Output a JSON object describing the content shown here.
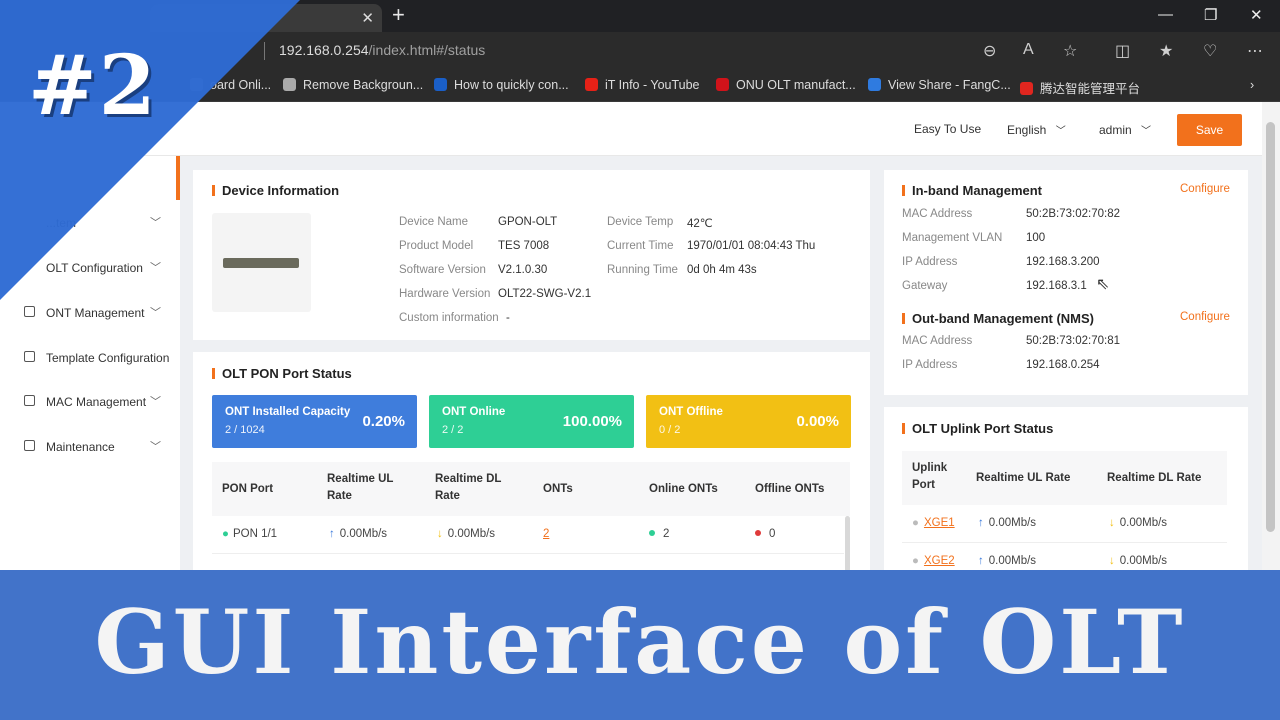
{
  "browser": {
    "url_host": "192.168.0.254",
    "url_path": "/index.html#/status",
    "bookmarks": [
      {
        "label": "oard Onli...",
        "color": "#888888"
      },
      {
        "label": "Remove Backgroun...",
        "color": "#aaaaaa"
      },
      {
        "label": "How to quickly con...",
        "color": "#1a5fc8"
      },
      {
        "label": "iT Info - YouTube",
        "color": "#e62117"
      },
      {
        "label": "ONU OLT manufact...",
        "color": "#d0131a"
      },
      {
        "label": "View Share - FangC...",
        "color": "#2f7be0"
      },
      {
        "label": "腾达智能管理平台",
        "color": "#e0261f"
      }
    ]
  },
  "header": {
    "easy_to_use": "Easy To Use",
    "language": "English",
    "user": "admin",
    "save": "Save"
  },
  "sidebar": {
    "items": [
      {
        "label": "...tem"
      },
      {
        "label": "OLT Configuration"
      },
      {
        "label": "ONT Management"
      },
      {
        "label": "Template Configuration"
      },
      {
        "label": "MAC Management"
      },
      {
        "label": "Maintenance"
      }
    ]
  },
  "device_info": {
    "title": "Device Information",
    "device_name_label": "Device Name",
    "device_name": "GPON-OLT",
    "product_model_label": "Product Model",
    "product_model": "TES 7008",
    "software_version_label": "Software Version",
    "software_version": "V2.1.0.30",
    "hardware_version_label": "Hardware Version",
    "hardware_version": "OLT22-SWG-V2.1",
    "custom_info_label": "Custom information",
    "custom_info": "-",
    "device_temp_label": "Device Temp",
    "device_temp": "42℃",
    "current_time_label": "Current Time",
    "current_time": "1970/01/01 08:04:43 Thu",
    "running_time_label": "Running Time",
    "running_time": "0d 0h 4m 43s"
  },
  "pon_status": {
    "title": "OLT PON Port Status",
    "kpis": [
      {
        "title": "ONT Installed Capacity",
        "sub": "2 / 1024",
        "pct": "0.20%",
        "color": "#3f7ddc"
      },
      {
        "title": "ONT Online",
        "sub": "2 / 2",
        "pct": "100.00%",
        "color": "#2ecf95"
      },
      {
        "title": "ONT Offline",
        "sub": "0 / 2",
        "pct": "0.00%",
        "color": "#f2c014"
      }
    ],
    "columns": [
      "PON Port",
      "Realtime UL Rate",
      "Realtime DL Rate",
      "ONTs",
      "Online ONTs",
      "Offline ONTs"
    ],
    "rows": [
      {
        "port": "PON 1/1",
        "ul": "0.00Mb/s",
        "dl": "0.00Mb/s",
        "onts": "2",
        "online": "2",
        "offline": "0"
      }
    ]
  },
  "inband": {
    "title": "In-band Management",
    "configure": "Configure",
    "mac_label": "MAC Address",
    "mac": "50:2B:73:02:70:82",
    "vlan_label": "Management VLAN",
    "vlan": "100",
    "ip_label": "IP Address",
    "ip": "192.168.3.200",
    "gw_label": "Gateway",
    "gw": "192.168.3.1"
  },
  "outband": {
    "title": "Out-band Management (NMS)",
    "configure": "Configure",
    "mac_label": "MAC Address",
    "mac": "50:2B:73:02:70:81",
    "ip_label": "IP Address",
    "ip": "192.168.0.254"
  },
  "uplink": {
    "title": "OLT Uplink Port Status",
    "columns": [
      "Uplink Port",
      "Realtime UL Rate",
      "Realtime DL Rate"
    ],
    "rows": [
      {
        "port": "XGE1",
        "ul": "0.00Mb/s",
        "dl": "0.00Mb/s"
      },
      {
        "port": "XGE2",
        "ul": "0.00Mb/s",
        "dl": "0.00Mb/s"
      }
    ]
  },
  "overlay": {
    "badge": "#2",
    "banner": "GUI Interface of OLT"
  }
}
